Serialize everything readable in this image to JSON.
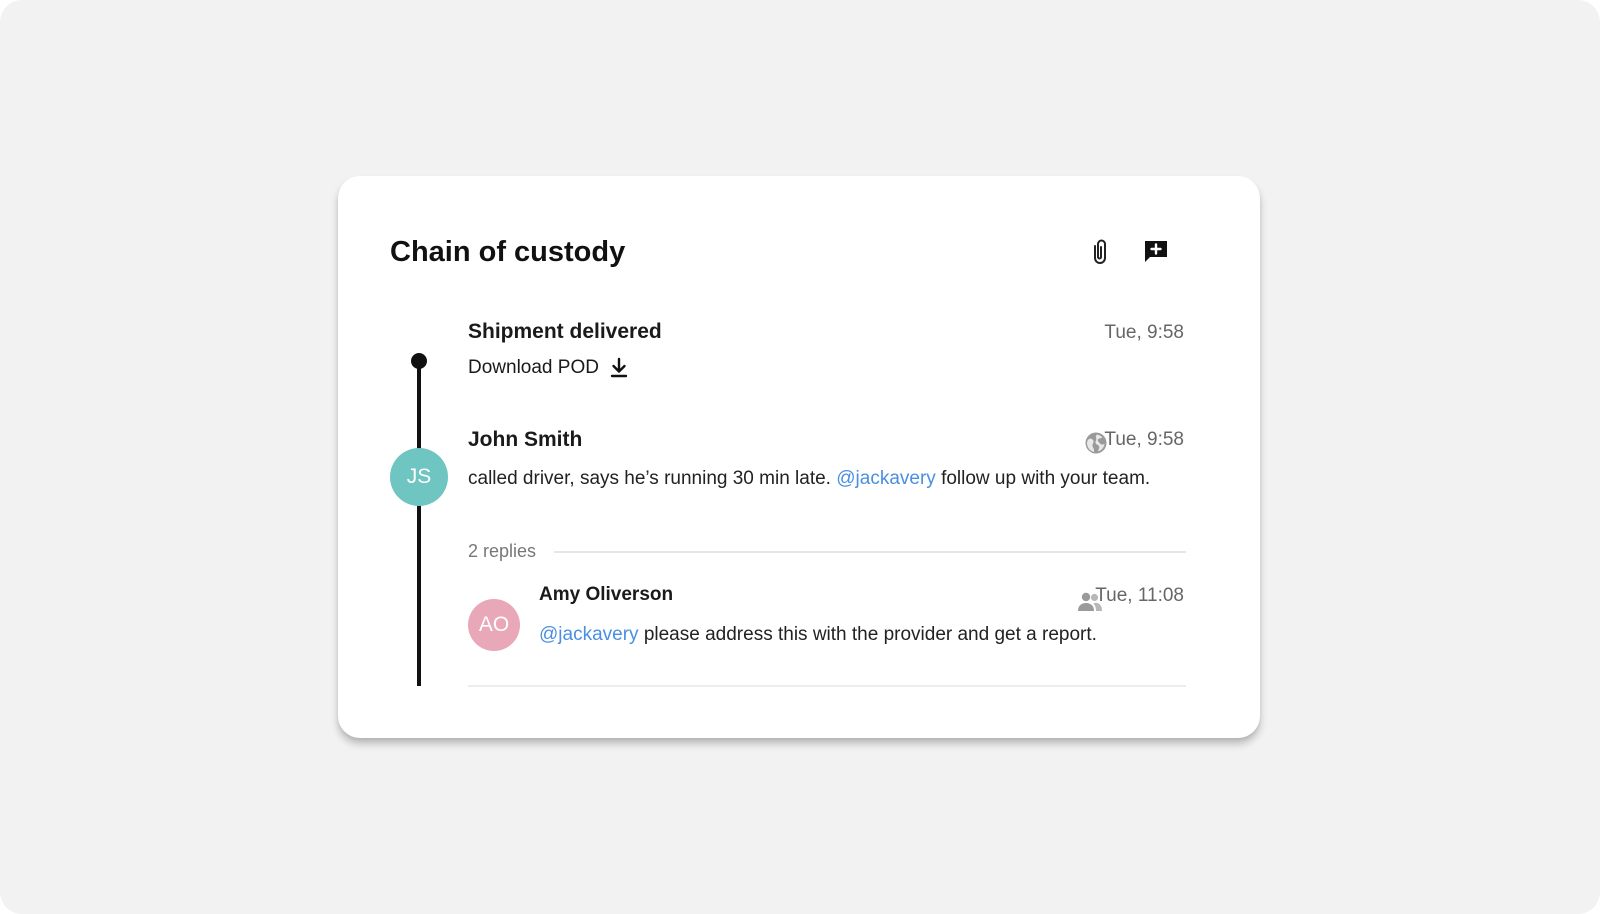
{
  "panel": {
    "title": "Chain of custody",
    "actions": {
      "attach_icon": "paperclip-icon",
      "add_comment_icon": "add-comment-icon"
    }
  },
  "events": [
    {
      "title": "Shipment delivered",
      "time": "Tue, 9:58",
      "link_label": "Download POD",
      "link_icon": "download-icon"
    }
  ],
  "comment": {
    "avatar_initials": "JS",
    "avatar_color": "#6fc5c1",
    "author": "John Smith",
    "visibility_icon": "globe-icon",
    "time": "Tue, 9:58",
    "text_before": "called driver, says he’s running 30 min late. ",
    "mention": "@jackavery",
    "text_after": " follow up with your team.",
    "replies_label": "2 replies"
  },
  "reply": {
    "avatar_initials": "AO",
    "avatar_color": "#e8a8b8",
    "author": "Amy Oliverson",
    "visibility_icon": "group-icon",
    "time": "Tue, 11:08",
    "mention": "@jackavery",
    "text_after": " please address this with the provider and get a report."
  },
  "colors": {
    "mention": "#4a8fe0",
    "timeline": "#111111",
    "background": "#f2f2f2"
  }
}
